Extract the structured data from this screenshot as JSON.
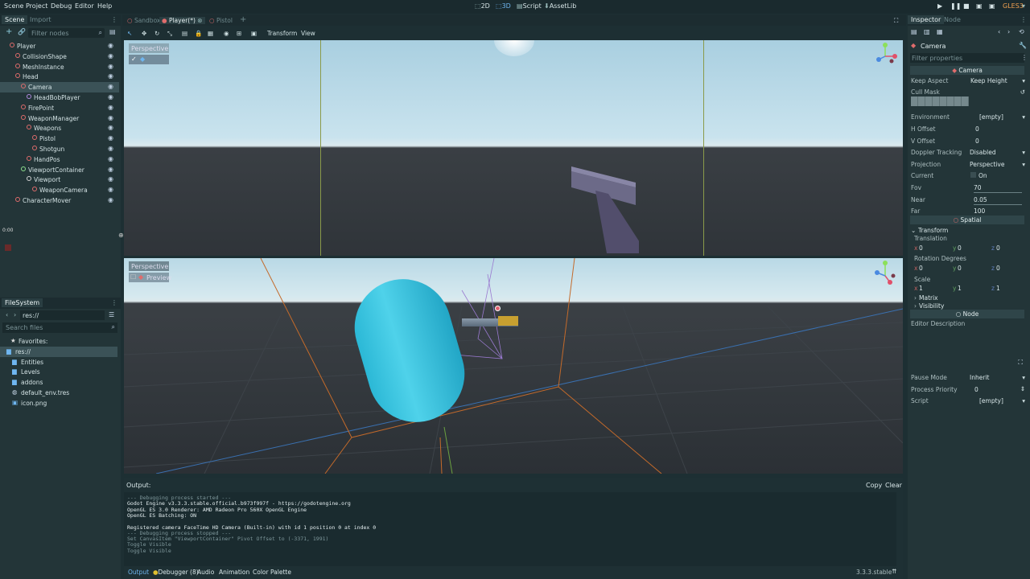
{
  "menubar": {
    "items": [
      "Scene",
      "Project",
      "Debug",
      "Editor",
      "Help"
    ],
    "workspaces": [
      "2D",
      "3D",
      "Script",
      "AssetLib"
    ],
    "renderer": "GLES3"
  },
  "scene_dock": {
    "tabs": [
      "Scene",
      "Import"
    ],
    "filter_placeholder": "Filter nodes",
    "nodes": [
      {
        "label": "Player",
        "depth": 0,
        "color": "#e06c6c"
      },
      {
        "label": "CollisionShape",
        "depth": 1,
        "color": "#e06c6c"
      },
      {
        "label": "MeshInstance",
        "depth": 1,
        "color": "#e06c6c"
      },
      {
        "label": "Head",
        "depth": 1,
        "color": "#e06c6c"
      },
      {
        "label": "Camera",
        "depth": 2,
        "color": "#e06c6c",
        "selected": true
      },
      {
        "label": "HeadBobPlayer",
        "depth": 3,
        "color": "#b08ae0"
      },
      {
        "label": "FirePoint",
        "depth": 2,
        "color": "#e06c6c"
      },
      {
        "label": "WeaponManager",
        "depth": 2,
        "color": "#e06c6c"
      },
      {
        "label": "Weapons",
        "depth": 3,
        "color": "#e06c6c"
      },
      {
        "label": "Pistol",
        "depth": 4,
        "color": "#e06c6c"
      },
      {
        "label": "Shotgun",
        "depth": 4,
        "color": "#e06c6c"
      },
      {
        "label": "HandPos",
        "depth": 3,
        "color": "#e06c6c"
      },
      {
        "label": "ViewportContainer",
        "depth": 2,
        "color": "#8ee08e"
      },
      {
        "label": "Viewport",
        "depth": 3,
        "color": "#d0d0d0"
      },
      {
        "label": "WeaponCamera",
        "depth": 4,
        "color": "#e06c6c"
      },
      {
        "label": "CharacterMover",
        "depth": 1,
        "color": "#e06c6c"
      }
    ],
    "timer": "0:00"
  },
  "filesystem": {
    "title": "FileSystem",
    "path": "res://",
    "search_placeholder": "Search files",
    "favorites_label": "Favorites:",
    "items": [
      {
        "label": "res://",
        "depth": 0,
        "type": "folder",
        "selected": true
      },
      {
        "label": "Entities",
        "depth": 1,
        "type": "folder"
      },
      {
        "label": "Levels",
        "depth": 1,
        "type": "folder"
      },
      {
        "label": "addons",
        "depth": 1,
        "type": "folder"
      },
      {
        "label": "default_env.tres",
        "depth": 1,
        "type": "resource"
      },
      {
        "label": "icon.png",
        "depth": 1,
        "type": "image"
      }
    ]
  },
  "scene_tabs": [
    "Sandbox",
    "Player(*)",
    "Pistol"
  ],
  "toolbar": {
    "transform": "Transform",
    "view": "View"
  },
  "viewport_top": {
    "label": "Perspective"
  },
  "viewport_bottom": {
    "label": "Perspective",
    "preview": "Preview"
  },
  "output": {
    "title": "Output:",
    "copy": "Copy",
    "clear": "Clear",
    "lines": [
      {
        "text": "--- Debugging process started ---",
        "dim": true
      },
      {
        "text": "Godot Engine v3.3.3.stable.official.b973f997f - https://godotengine.org",
        "dim": false
      },
      {
        "text": "OpenGL ES 3.0 Renderer: AMD Radeon Pro 560X OpenGL Engine",
        "dim": false
      },
      {
        "text": "OpenGL ES Batching: ON",
        "dim": false
      },
      {
        "text": "",
        "dim": false
      },
      {
        "text": "Registered camera FaceTime HD Camera (Built-in) with id 1 position 0 at index 0",
        "dim": false
      },
      {
        "text": "--- Debugging process stopped ---",
        "dim": true
      },
      {
        "text": "Set CanvasItem \"ViewportContainer\" Pivot Offset to (-3371, 1991)",
        "dim": true
      },
      {
        "text": "Toggle Visible",
        "dim": true
      },
      {
        "text": "Toggle Visible",
        "dim": true
      }
    ],
    "tabs": [
      "Output",
      "Debugger (8)",
      "Audio",
      "Animation",
      "Color Palette"
    ],
    "version": "3.3.3.stable"
  },
  "inspector": {
    "tabs": [
      "Inspector",
      "Node"
    ],
    "object": "Camera",
    "filter_placeholder": "Filter properties",
    "section_camera": "Camera",
    "props": [
      {
        "label": "Keep Aspect",
        "value": "Keep Height"
      },
      {
        "label": "Cull Mask",
        "value": ""
      },
      {
        "label": "Environment",
        "value": "[empty]"
      },
      {
        "label": "H Offset",
        "value": "0"
      },
      {
        "label": "V Offset",
        "value": "0"
      },
      {
        "label": "Doppler Tracking",
        "value": "Disabled"
      },
      {
        "label": "Projection",
        "value": "Perspective"
      },
      {
        "label": "Current",
        "value": "On"
      },
      {
        "label": "Fov",
        "value": "70"
      },
      {
        "label": "Near",
        "value": "0.05"
      },
      {
        "label": "Far",
        "value": "100"
      }
    ],
    "section_spatial": "Spatial",
    "transform": "Transform",
    "translation": {
      "label": "Translation",
      "x": "0",
      "y": "0",
      "z": "0"
    },
    "rotation": {
      "label": "Rotation Degrees",
      "x": "0",
      "y": "0",
      "z": "0"
    },
    "scale": {
      "label": "Scale",
      "x": "1",
      "y": "1",
      "z": "1"
    },
    "matrix": "Matrix",
    "visibility": "Visibility",
    "section_node": "Node",
    "editor_description": "Editor Description",
    "pause_mode": {
      "label": "Pause Mode",
      "value": "Inherit"
    },
    "process_priority": {
      "label": "Process Priority",
      "value": "0"
    },
    "script": {
      "label": "Script",
      "value": "[empty]"
    }
  }
}
